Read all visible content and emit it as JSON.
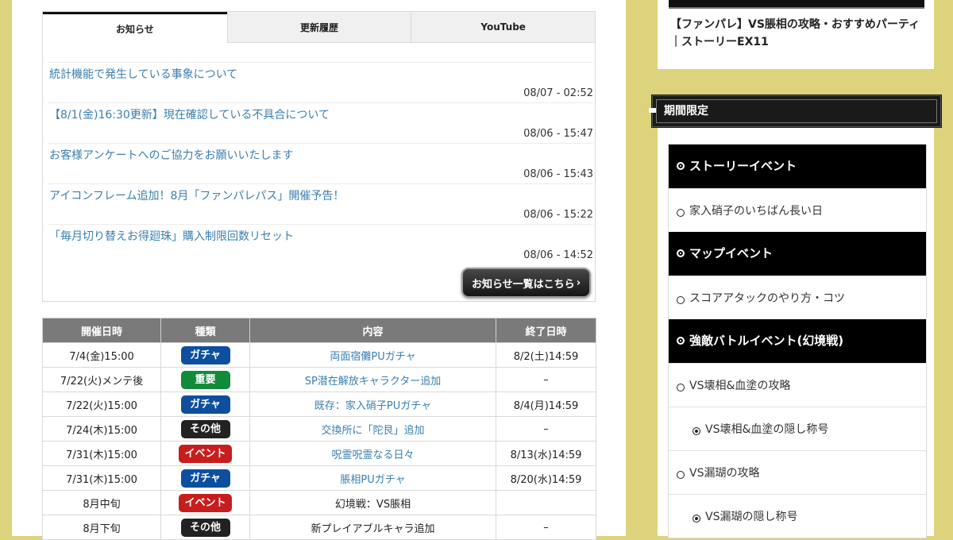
{
  "news": {
    "tabs": [
      "お知らせ",
      "更新履歴",
      "YouTube"
    ],
    "items": [
      {
        "title": "統計機能で発生している事象について",
        "date": "08/07 - 02:52"
      },
      {
        "title": "【8/1(金)16:30更新】現在確認している不具合について",
        "date": "08/06 - 15:47"
      },
      {
        "title": "お客様アンケートへのご協力をお願いいたします",
        "date": "08/06 - 15:43"
      },
      {
        "title": "アイコンフレーム追加！8月「ファンパレパス」開催予告！",
        "date": "08/06 - 15:22"
      },
      {
        "title": "「毎月切り替えお得廻珠」購入制限回数リセット",
        "date": "08/06 - 14:52"
      }
    ],
    "more_button": "お知らせ一覧はこちら",
    "more_arrow": "›"
  },
  "schedule": {
    "headers": [
      "開催日時",
      "種類",
      "内容",
      "終了日時"
    ],
    "rows": [
      {
        "start": "7/4(金)15:00",
        "type": "ガチャ",
        "content": "両面宿儺PUガチャ",
        "end": "8/2(土)14:59",
        "link": true
      },
      {
        "start": "7/22(火)メンテ後",
        "type": "重要",
        "content": "SP潜在解放キャラクター追加",
        "end": "–",
        "link": true
      },
      {
        "start": "7/22(火)15:00",
        "type": "ガチャ",
        "content": "既存：家入硝子PUガチャ",
        "end": "8/4(月)14:59",
        "link": true
      },
      {
        "start": "7/24(木)15:00",
        "type": "その他",
        "content": "交換所に「陀艮」追加",
        "end": "–",
        "link": true
      },
      {
        "start": "7/31(木)15:00",
        "type": "イベント",
        "content": "呪霊呪霊なる日々",
        "end": "8/13(水)14:59",
        "link": true
      },
      {
        "start": "7/31(木)15:00",
        "type": "ガチャ",
        "content": "脹相PUガチャ",
        "end": "8/20(水)14:59",
        "link": true
      },
      {
        "start": "8月中旬",
        "type": "イベント",
        "content": "幻境戦：VS脹相",
        "end": "",
        "link": false
      },
      {
        "start": "8月下旬",
        "type": "その他",
        "content": "新プレイアブルキャラ追加",
        "end": "–",
        "link": false
      }
    ],
    "badge_colors": {
      "ガチャ": "#0d4f9e",
      "重要": "#118a3a",
      "その他": "#222222",
      "イベント": "#c81d1d"
    }
  },
  "sidebar": {
    "top_card_title": "【ファンパレ】VS脹相の攻略・おすすめパーティ｜ストーリーEX11",
    "section_title": "期間限定",
    "menu": [
      {
        "level": "cat",
        "label": "ストーリーイベント"
      },
      {
        "level": "sub",
        "label": "家入硝子のいちばん長い日"
      },
      {
        "level": "cat",
        "label": "マップイベント"
      },
      {
        "level": "sub",
        "label": "スコアアタックのやり方・コツ"
      },
      {
        "level": "cat",
        "label": "強敵バトルイベント(幻境戦)"
      },
      {
        "level": "sub",
        "label": "VS壊相&血塗の攻略"
      },
      {
        "level": "sub2",
        "label": "VS壊相&血塗の隠し称号"
      },
      {
        "level": "sub",
        "label": "VS漏瑚の攻略"
      },
      {
        "level": "sub2",
        "label": "VS漏瑚の隠し称号"
      }
    ]
  }
}
